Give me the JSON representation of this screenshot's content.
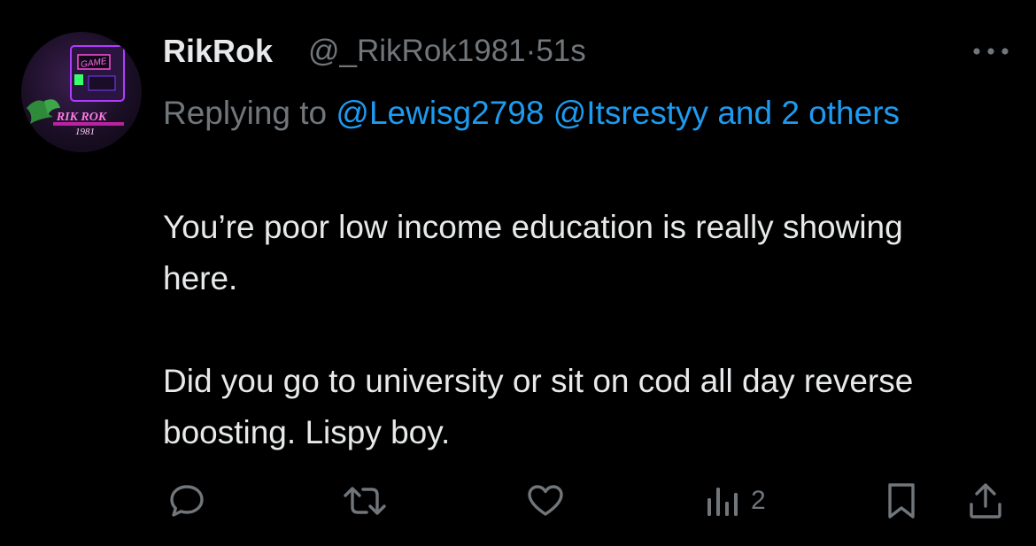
{
  "tweet": {
    "display_name": "RikRok",
    "handle": "@_RikRok1981",
    "separator": "·",
    "time": "51s",
    "avatar": {
      "logo_text": "RIK ROK",
      "logo_sub": "1981",
      "sign_text": "GAME"
    },
    "reply": {
      "prefix": "Replying to ",
      "mention1": "@Lewisg2798",
      "mention2": "@Itsrestyy",
      "others": "and 2 others"
    },
    "body": {
      "paragraph1": "You’re poor low income education is really showing here.",
      "paragraph2": "Did you go to university or sit on cod all day reverse boosting. Lispy boy."
    }
  },
  "actions": {
    "reply_icon": "speech-bubble-icon",
    "retweet_icon": "retweet-icon",
    "like_icon": "heart-icon",
    "views_icon": "bar-chart-icon",
    "views_count": "2",
    "bookmark_icon": "bookmark-icon",
    "share_icon": "share-icon"
  },
  "colors": {
    "background": "#000000",
    "text": "#e7e9ea",
    "muted": "#71767b",
    "link": "#1d9bf0"
  }
}
